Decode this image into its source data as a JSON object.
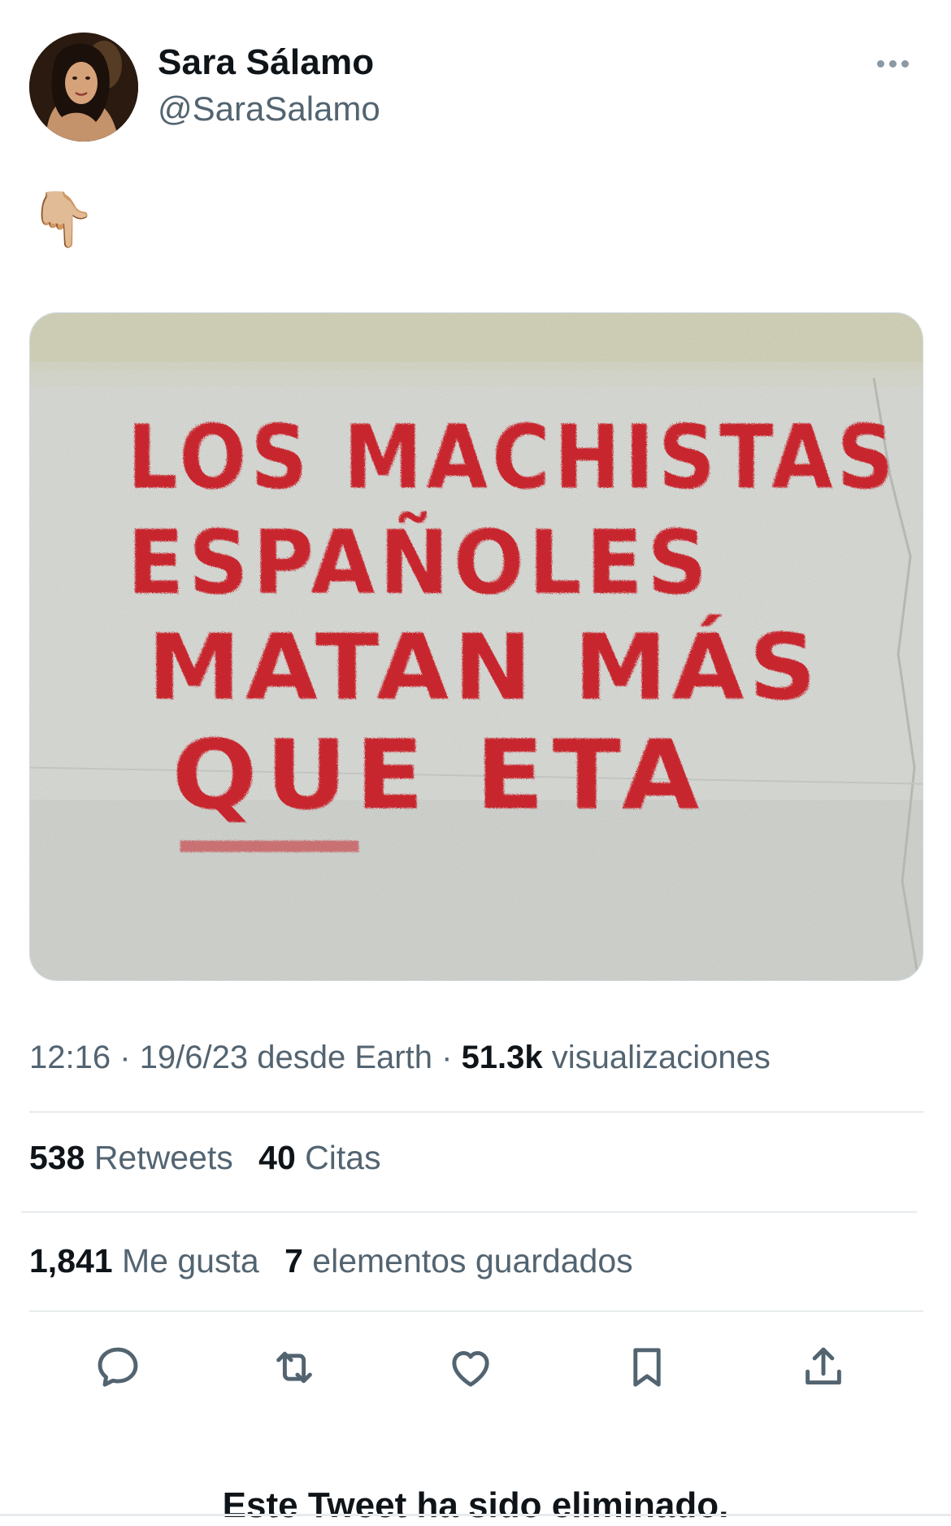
{
  "tweet": {
    "author_name": "Sara Sálamo",
    "author_handle": "@SaraSalamo",
    "text": "👇🏼",
    "media_text": "LOS MACHISTAS ESPAÑOLES MATAN MÁS QUE ETA",
    "media_lines": [
      "LOS MACHISTAS",
      "ESPAÑOLES",
      "MATAN MÁS",
      "QUE ETA"
    ],
    "time": "12:16",
    "date": "19/6/23",
    "source": "desde Earth",
    "views_count": "51.3k",
    "views_label": "visualizaciones",
    "separator": "·"
  },
  "stats": {
    "retweets_count": "538",
    "retweets_label": "Retweets",
    "quotes_count": "40",
    "quotes_label": "Citas",
    "likes_count": "1,841",
    "likes_label": "Me gusta",
    "bookmarks_count": "7",
    "bookmarks_label": "elementos guardados"
  },
  "actions": [
    {
      "name": "reply",
      "icon": "speech-bubble-icon"
    },
    {
      "name": "retweet",
      "icon": "retweet-arrows-icon"
    },
    {
      "name": "like",
      "icon": "heart-icon"
    },
    {
      "name": "bookmark",
      "icon": "bookmark-icon"
    },
    {
      "name": "share",
      "icon": "share-upload-icon"
    }
  ],
  "notice": {
    "deleted_text": "Este Tweet ha sido eliminado."
  },
  "colors": {
    "text_primary": "#0f1419",
    "text_secondary": "#536471",
    "icon": "#536471",
    "divider": "#e7ebee",
    "graffiti_red": "#c8262e",
    "wall": "#d9dcd8"
  }
}
